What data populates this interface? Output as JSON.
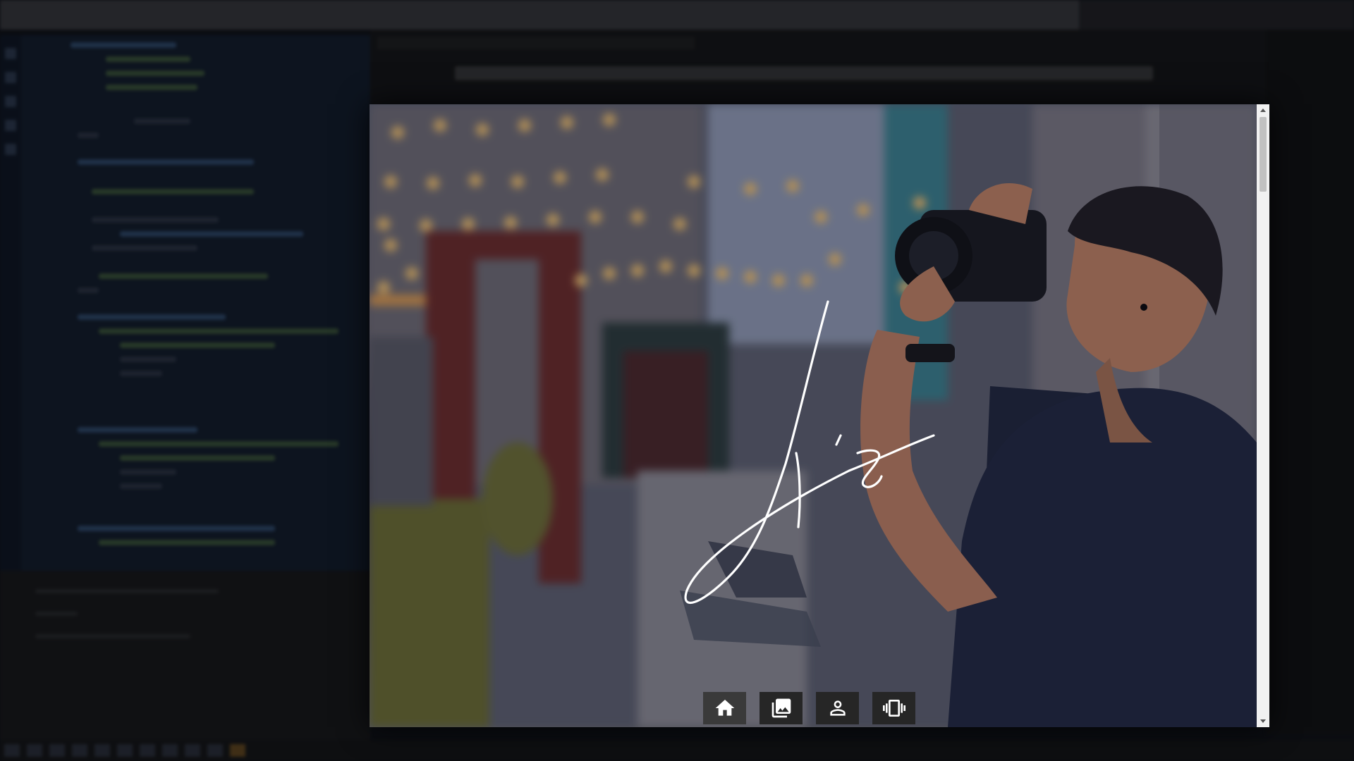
{
  "window": {
    "title": ""
  },
  "hero": {
    "signature_text": "A's",
    "signature_color": "#ffffff"
  },
  "nav": {
    "items": [
      {
        "id": "home",
        "icon": "home-icon",
        "active": true
      },
      {
        "id": "gallery",
        "icon": "image-gallery-icon",
        "active": false
      },
      {
        "id": "profile",
        "icon": "person-icon",
        "active": false
      },
      {
        "id": "contact",
        "icon": "vibrate-phone-icon",
        "active": false
      }
    ],
    "button_background": "#262626",
    "icon_color": "#ffffff"
  },
  "scrollbar": {
    "position": 0.0
  }
}
